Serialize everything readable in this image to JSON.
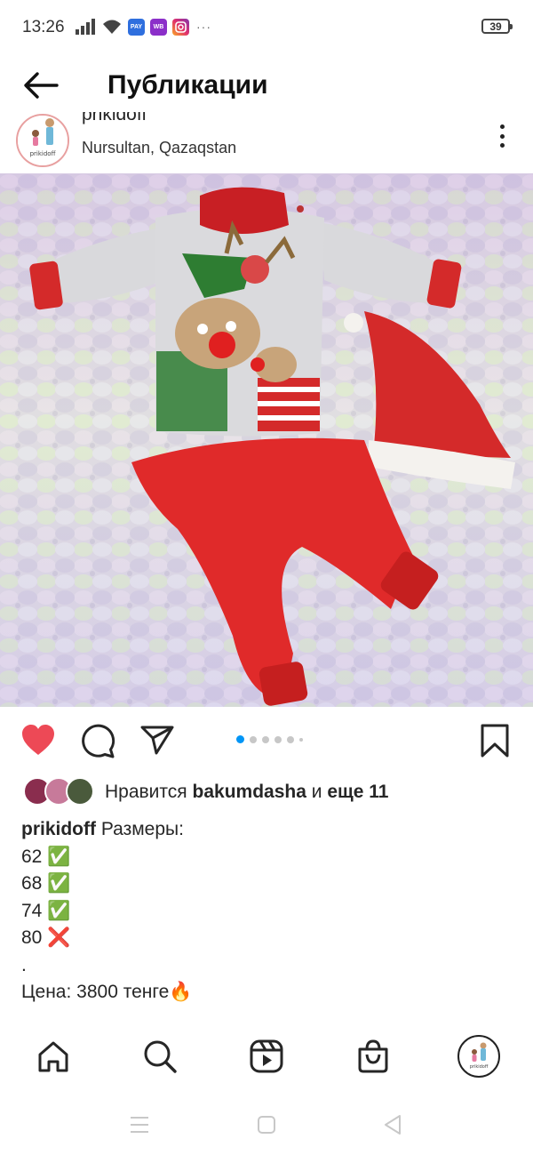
{
  "status_bar": {
    "time": "13:26",
    "battery": "39",
    "app_badges": [
      {
        "name": "bank-app-icon",
        "label": "PAY",
        "color": "#2f6fde"
      },
      {
        "name": "wildberries-app-icon",
        "label": "WB",
        "color": "#8b2fc9"
      },
      {
        "name": "instagram-app-icon",
        "label": "",
        "color": "#e1306c"
      }
    ],
    "more": "···"
  },
  "header": {
    "title": "Публикации"
  },
  "post": {
    "username": "prikidoff",
    "location": "Nursultan, Qazaqstan",
    "image_alt": "",
    "carousel_pages": 6,
    "carousel_active": 1
  },
  "likes": {
    "prefix": "Нравится",
    "user": "bakumdasha",
    "conj": "и",
    "others": "еще 11"
  },
  "caption": {
    "username": "prikidoff",
    "text": "Размеры:",
    "sizes": [
      {
        "size": "62",
        "mark": "✅",
        "available": true
      },
      {
        "size": "68",
        "mark": "✅",
        "available": true
      },
      {
        "size": "74",
        "mark": "✅",
        "available": true
      },
      {
        "size": "80",
        "mark": "❌",
        "available": false
      }
    ],
    "dot": ".",
    "price": "Цена: 3800 тенге🔥"
  },
  "colors": {
    "like_red": "#ed4956",
    "accent_blue": "#0095f6"
  }
}
